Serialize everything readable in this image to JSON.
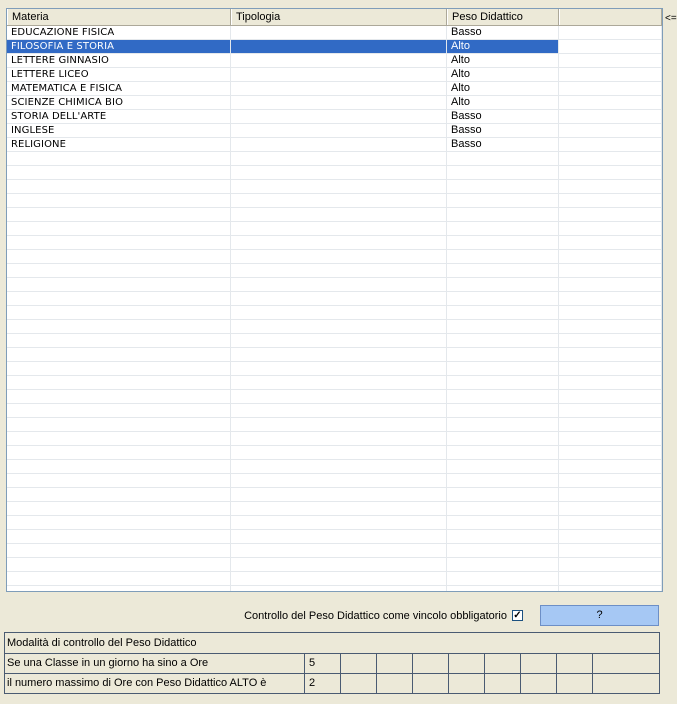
{
  "grid": {
    "columns": [
      "Materia",
      "Tipologia",
      "Peso Didattico",
      ""
    ],
    "rows": [
      {
        "materia": "EDUCAZIONE FISICA",
        "tipologia": "",
        "peso": "Basso"
      },
      {
        "materia": "FILOSOFIA E STORIA",
        "tipologia": "",
        "peso": "Alto"
      },
      {
        "materia": "LETTERE GINNASIO",
        "tipologia": "",
        "peso": "Alto"
      },
      {
        "materia": "LETTERE LICEO",
        "tipologia": "",
        "peso": "Alto"
      },
      {
        "materia": "MATEMATICA E FISICA",
        "tipologia": "",
        "peso": "Alto"
      },
      {
        "materia": "SCIENZE CHIMICA BIO",
        "tipologia": "",
        "peso": "Alto"
      },
      {
        "materia": "STORIA DELL'ARTE",
        "tipologia": "",
        "peso": "Basso"
      },
      {
        "materia": "INGLESE",
        "tipologia": "",
        "peso": "Basso"
      },
      {
        "materia": "RELIGIONE",
        "tipologia": "",
        "peso": "Basso"
      }
    ],
    "selected_row": 1
  },
  "side_label": "<=",
  "control": {
    "label": "Controllo del Peso Didattico come vincolo obbligatorio",
    "checked": true,
    "check_glyph": "✓",
    "help_label": "?"
  },
  "panel": {
    "title": "Modalità di controllo del Peso Didattico",
    "rows": [
      {
        "label": "Se una Classe in un giorno ha sino a Ore",
        "value": "5"
      },
      {
        "label": "il numero massimo di Ore con Peso Didattico ALTO è",
        "value": "2"
      }
    ]
  }
}
